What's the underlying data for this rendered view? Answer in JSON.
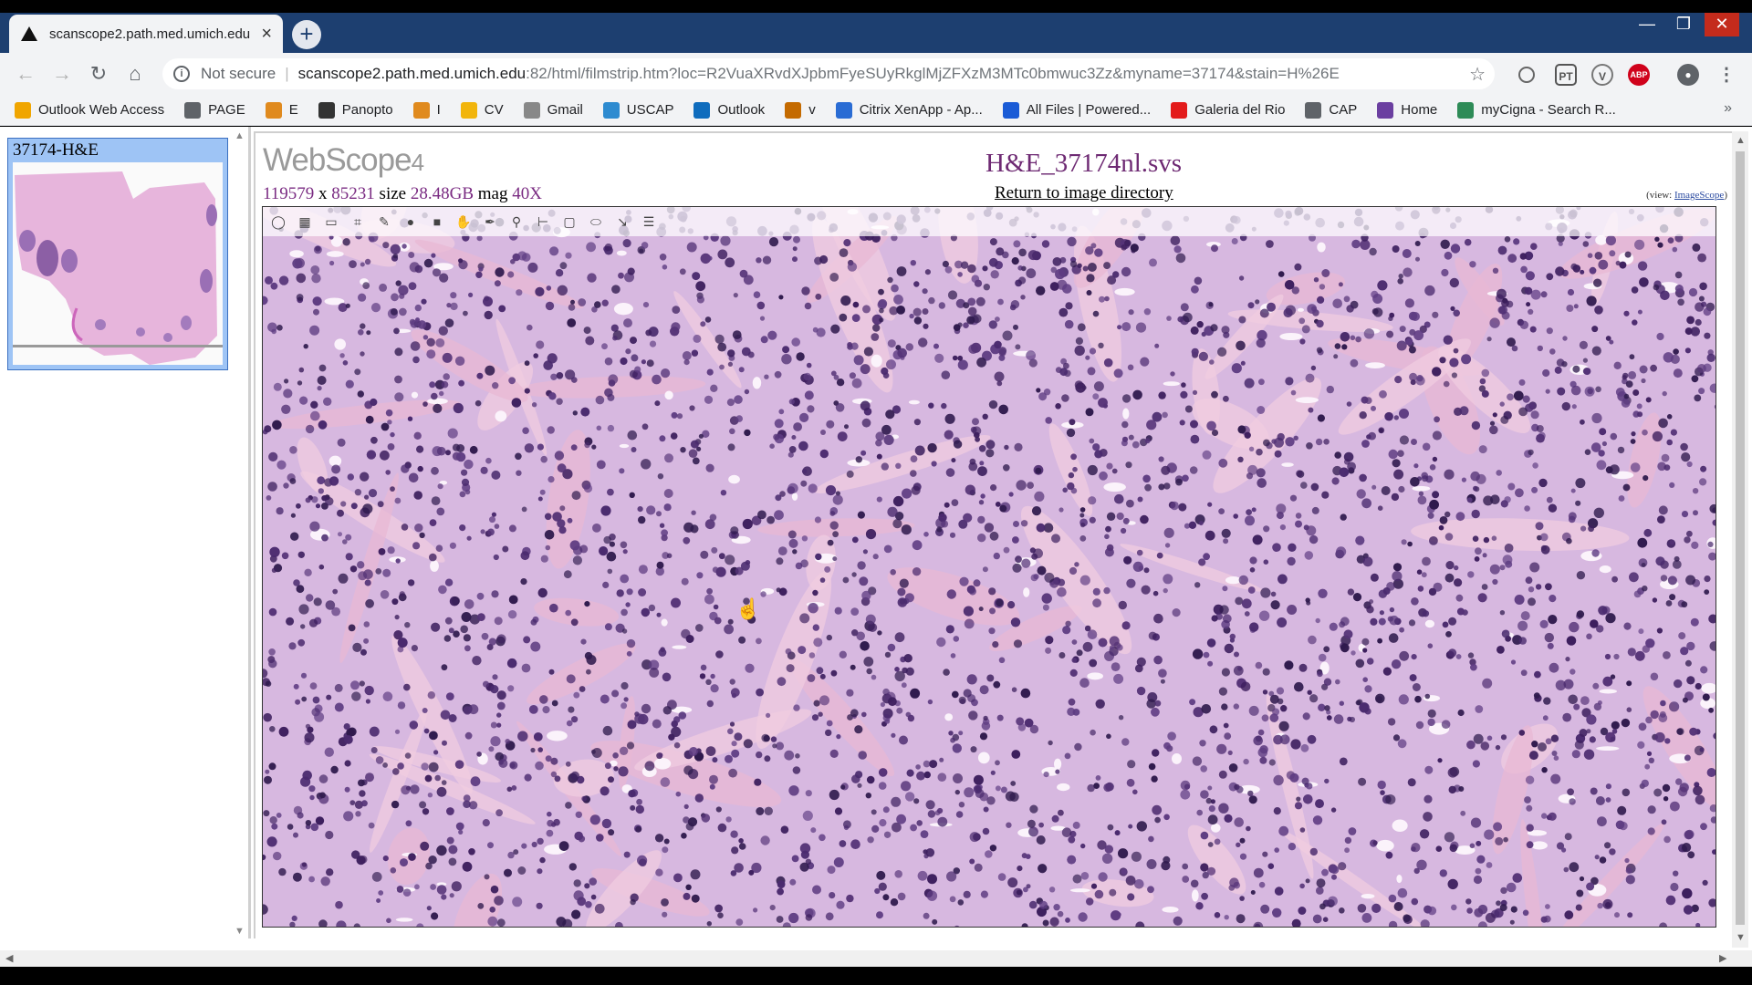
{
  "browser": {
    "tab_title": "scanscope2.path.med.umich.edu",
    "new_tab": "+",
    "window_controls": [
      "—",
      "❐",
      "✕"
    ],
    "address": {
      "not_secure": "Not secure",
      "host": "scanscope2.path.med.umich.edu",
      "path": ":82/html/filmstrip.htm?loc=R2VuaXRvdXJpbmFyeSUyRkglMjZFXzM3MTc0bmwuc3Zz&myname=37174&stain=H%26E"
    },
    "bookmarks": [
      {
        "label": "Outlook Web Access",
        "icon": "outlook-web-icon",
        "color": "#f0a500"
      },
      {
        "label": "PAGE",
        "icon": "globe-icon",
        "color": "#5f6368"
      },
      {
        "label": "E",
        "icon": "e-icon",
        "color": "#e08a1e"
      },
      {
        "label": "Panopto",
        "icon": "panopto-icon",
        "color": "#333"
      },
      {
        "label": "I",
        "icon": "e-icon",
        "color": "#e08a1e"
      },
      {
        "label": "CV",
        "icon": "folder-icon",
        "color": "#f2b50c"
      },
      {
        "label": "Gmail",
        "icon": "gmail-icon",
        "color": "#888"
      },
      {
        "label": "USCAP",
        "icon": "cloud-icon",
        "color": "#2e8bd0"
      },
      {
        "label": "Outlook",
        "icon": "outlook-icon",
        "color": "#0f6cbd"
      },
      {
        "label": "v",
        "icon": "v-icon",
        "color": "#c46a00"
      },
      {
        "label": "Citrix XenApp - Ap...",
        "icon": "citrix-icon",
        "color": "#2a6cd4"
      },
      {
        "label": "All Files | Powered...",
        "icon": "box-icon",
        "color": "#1a5bd6"
      },
      {
        "label": "Galeria del Rio",
        "icon": "galeria-icon",
        "color": "#e31b1b"
      },
      {
        "label": "CAP",
        "icon": "globe-icon",
        "color": "#5f6368"
      },
      {
        "label": "Home",
        "icon": "ae-icon",
        "color": "#6b3fa0"
      },
      {
        "label": "myCigna - Search R...",
        "icon": "cigna-icon",
        "color": "#2e8b57"
      }
    ],
    "bookmarks_more": "»"
  },
  "filmstrip": {
    "label": "37174-H&E"
  },
  "viewer_header": {
    "logo": "WebScope",
    "logo_version": "4",
    "file_title": "H&E_37174nl.svs",
    "return_link": "Return to image directory",
    "view_prefix": "(view: ",
    "view_link": "ImageScope",
    "view_suffix": ")",
    "width": "119579",
    "x_sep": " x ",
    "height": "85231",
    "size_label": " size ",
    "size": "28.48GB",
    "mag_label": " mag ",
    "mag": "40X"
  },
  "tools": [
    {
      "name": "navigate-tool-icon",
      "glyph": "◯"
    },
    {
      "name": "thumbnail-tool-icon",
      "glyph": "▦"
    },
    {
      "name": "zoom-slider-tool-icon",
      "glyph": "▭"
    },
    {
      "name": "annotation-tool-icon",
      "glyph": "⌗"
    },
    {
      "name": "edit-tool-icon",
      "glyph": "✎"
    },
    {
      "name": "color-tool-icon",
      "glyph": "●"
    },
    {
      "name": "save-tool-icon",
      "glyph": "■"
    },
    {
      "name": "pan-hand-tool-icon",
      "glyph": "✋"
    },
    {
      "name": "pen-tool-icon",
      "glyph": "✒"
    },
    {
      "name": "magnify-tool-icon",
      "glyph": "⚲"
    },
    {
      "name": "ruler-tool-icon",
      "glyph": "⊢"
    },
    {
      "name": "rectangle-tool-icon",
      "glyph": "▢"
    },
    {
      "name": "ellipse-tool-icon",
      "glyph": "⬭"
    },
    {
      "name": "arrow-tool-icon",
      "glyph": "↘"
    },
    {
      "name": "layers-tool-icon",
      "glyph": "☰"
    }
  ],
  "colors": {
    "chrome_blue": "#1d3f70",
    "title_purple": "#6e2a73",
    "tissue_pink": "#c9a6d8",
    "nucleus_purple": "#3d1f5e"
  }
}
